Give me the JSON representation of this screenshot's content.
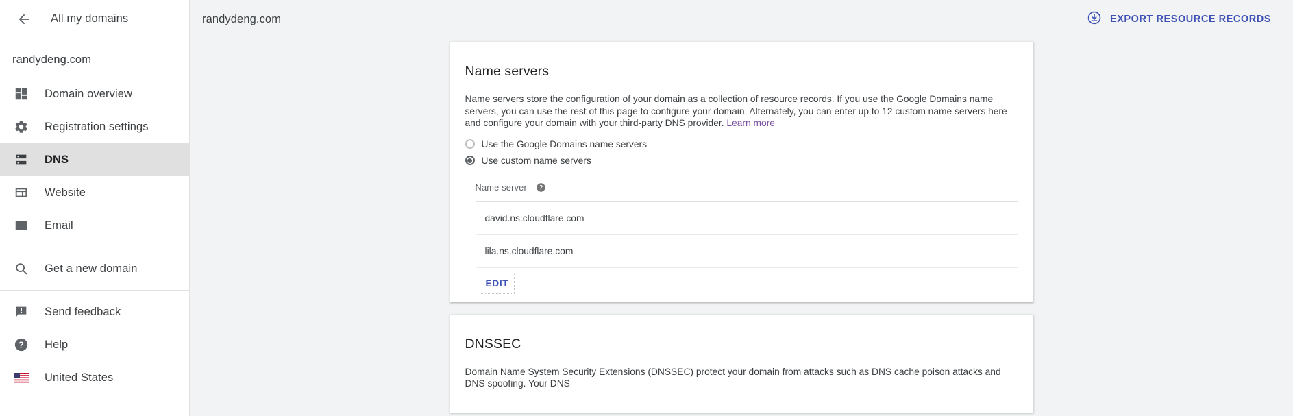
{
  "sidebar": {
    "back_label": "All my domains",
    "domain": "randydeng.com",
    "groups": [
      {
        "items": [
          {
            "label": "Domain overview",
            "icon": "dashboard-icon",
            "active": false
          },
          {
            "label": "Registration settings",
            "icon": "gear-icon",
            "active": false
          },
          {
            "label": "DNS",
            "icon": "dns-server-icon",
            "active": true
          },
          {
            "label": "Website",
            "icon": "web-page-icon",
            "active": false
          },
          {
            "label": "Email",
            "icon": "envelope-icon",
            "active": false
          }
        ]
      },
      {
        "items": [
          {
            "label": "Get a new domain",
            "icon": "search-icon",
            "active": false
          }
        ]
      },
      {
        "items": [
          {
            "label": "Send feedback",
            "icon": "feedback-icon",
            "active": false
          },
          {
            "label": "Help",
            "icon": "help-circle-icon",
            "active": false
          },
          {
            "label": "United States",
            "icon": "us-flag-icon",
            "active": false
          }
        ]
      }
    ]
  },
  "header": {
    "title": "randydeng.com",
    "export_label": "EXPORT RESOURCE RECORDS",
    "export_icon": "download-circle-icon"
  },
  "name_servers_card": {
    "title": "Name servers",
    "description_part1": "Name servers store the configuration of your domain as a collection of resource records. If you use the Google Domains name servers, you can use the rest of this page to configure your domain. Alternately, you can enter up to 12 custom name servers here and configure your domain with your third-party DNS provider. ",
    "learn_more": "Learn more",
    "options": [
      {
        "label": "Use the Google Domains name servers",
        "selected": false
      },
      {
        "label": "Use custom name servers",
        "selected": true
      }
    ],
    "table_header": "Name server",
    "help_icon": "help-circle-icon",
    "rows": [
      "david.ns.cloudflare.com",
      "lila.ns.cloudflare.com"
    ],
    "edit_label": "EDIT"
  },
  "dnssec_card": {
    "title": "DNSSEC",
    "description": "Domain Name System Security Extensions (DNSSEC) protect your domain from attacks such as DNS cache poison attacks and DNS spoofing. Your DNS"
  },
  "colors": {
    "accent": "#3f51b5",
    "link_visited": "#7b4fa0",
    "active_nav_bg": "#e0e0e0",
    "page_bg": "#f1f3f4",
    "text_primary": "#3c4043"
  }
}
